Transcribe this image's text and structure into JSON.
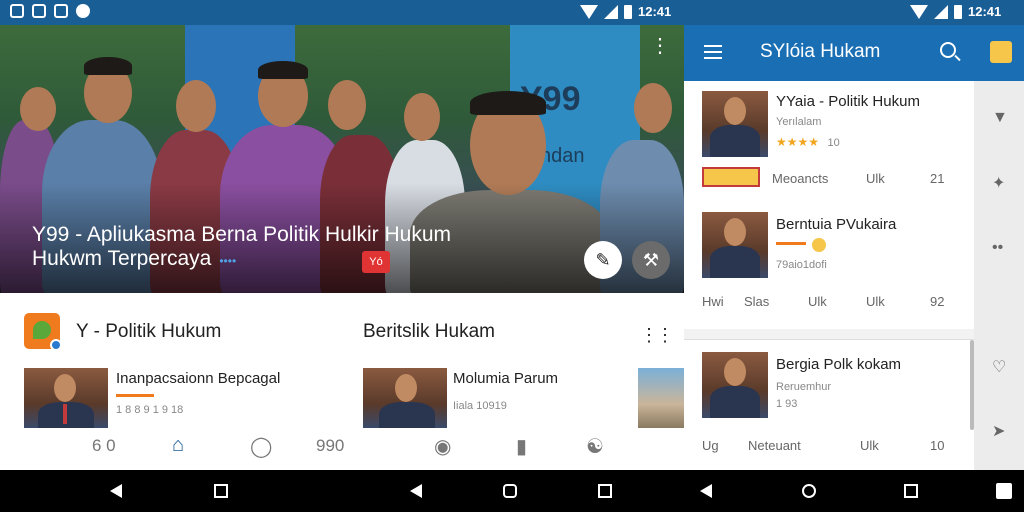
{
  "status_bar": {
    "time_1": "12:41",
    "time_2": "12:41"
  },
  "hero": {
    "title_line1": "Y99 - Apliukasma Berna Politik Hulkir Hukum",
    "title_line2": "Hukwm Terpercaya",
    "dots": "••••",
    "badge": "Yó",
    "sign_text": "Y99",
    "sign_subtext": "ndan",
    "more_icon": "more-vertical-icon",
    "fab1_icon": "pencil-icon",
    "fab2_icon": "hammer-icon"
  },
  "left_section": {
    "title_1": "Y - Politik Hukum",
    "title_2": "Beritslik Hukam",
    "card_1": {
      "title": "Inanpacsaionn Bepcagal",
      "sub": "1 8 8 9 1 9 18"
    },
    "card_2": {
      "title": "Molumia Parum",
      "sub": "Iiala 10919"
    }
  },
  "left_nav": {
    "item_1": "6 0",
    "item_4": "990"
  },
  "app_bar": {
    "title": "SYlóia Hukam"
  },
  "feed": {
    "card_1": {
      "title": "YYaia - Politik Hukum",
      "sub": "Yerılalam",
      "rating_stars": "★★★★",
      "rating_value": "10",
      "meta_1": "Meoancts",
      "meta_2": "Ulk",
      "meta_3": "21"
    },
    "card_2": {
      "title": "Berntuia PVukaira",
      "sub": "79aio1dofi",
      "meta_1": "Hwi",
      "meta_2": "Slas",
      "meta_3": "Ulk",
      "meta_4": "Ulk",
      "meta_5": "92"
    },
    "card_3": {
      "title": "Bergia Polk kokam",
      "sub_1": "Reruemhur",
      "sub_2": "1 93",
      "meta_1": "Ug",
      "meta_2": "Neteuant",
      "meta_3": "Ulk",
      "meta_4": "10"
    }
  },
  "colors": {
    "status_bar": "#1a5e96",
    "app_bar": "#1a6fb4",
    "accent_orange": "#f07a1e",
    "badge_red": "#e03434",
    "star_yellow": "#f2a51e"
  }
}
